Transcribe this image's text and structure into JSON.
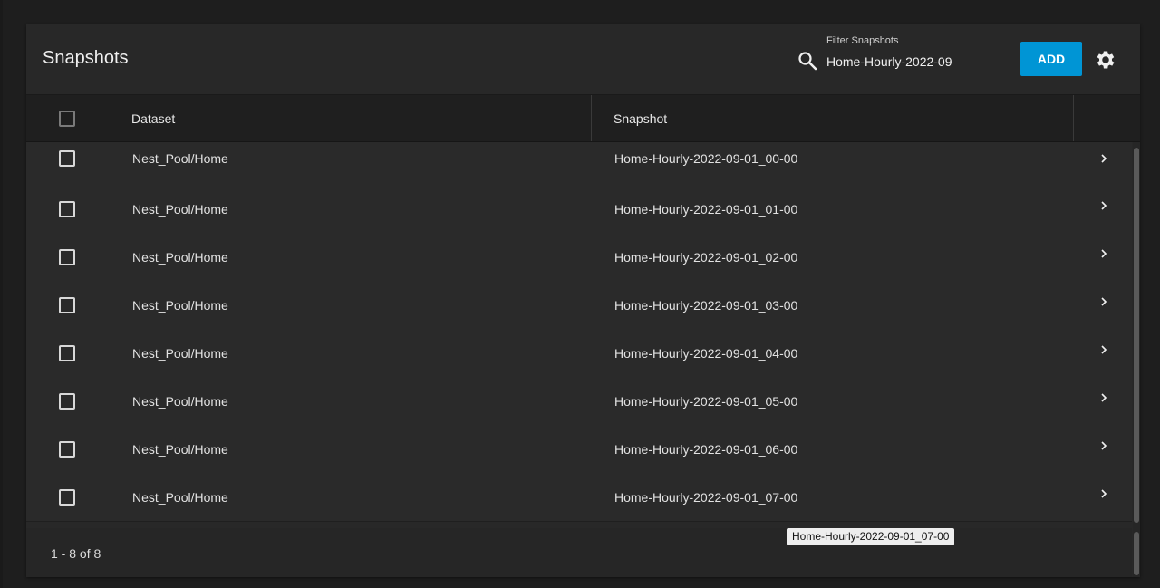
{
  "header": {
    "title": "Snapshots",
    "filter_label": "Filter Snapshots",
    "filter_value": "Home-Hourly-2022-09",
    "add_label": "ADD"
  },
  "table": {
    "columns": [
      "Dataset",
      "Snapshot"
    ],
    "rows": [
      {
        "dataset": "Nest_Pool/Home",
        "snapshot": "Home-Hourly-2022-09-01_00-00"
      },
      {
        "dataset": "Nest_Pool/Home",
        "snapshot": "Home-Hourly-2022-09-01_01-00"
      },
      {
        "dataset": "Nest_Pool/Home",
        "snapshot": "Home-Hourly-2022-09-01_02-00"
      },
      {
        "dataset": "Nest_Pool/Home",
        "snapshot": "Home-Hourly-2022-09-01_03-00"
      },
      {
        "dataset": "Nest_Pool/Home",
        "snapshot": "Home-Hourly-2022-09-01_04-00"
      },
      {
        "dataset": "Nest_Pool/Home",
        "snapshot": "Home-Hourly-2022-09-01_05-00"
      },
      {
        "dataset": "Nest_Pool/Home",
        "snapshot": "Home-Hourly-2022-09-01_06-00"
      },
      {
        "dataset": "Nest_Pool/Home",
        "snapshot": "Home-Hourly-2022-09-01_07-00"
      }
    ]
  },
  "footer": {
    "range_text": "1 - 8 of 8"
  },
  "tooltip": {
    "text": "Home-Hourly-2022-09-01_07-00"
  },
  "colors": {
    "accent": "#0095d5",
    "background": "#1e1e1e",
    "card": "#282828"
  },
  "icons": [
    "search-icon",
    "gear-icon",
    "chevron-right-icon"
  ]
}
